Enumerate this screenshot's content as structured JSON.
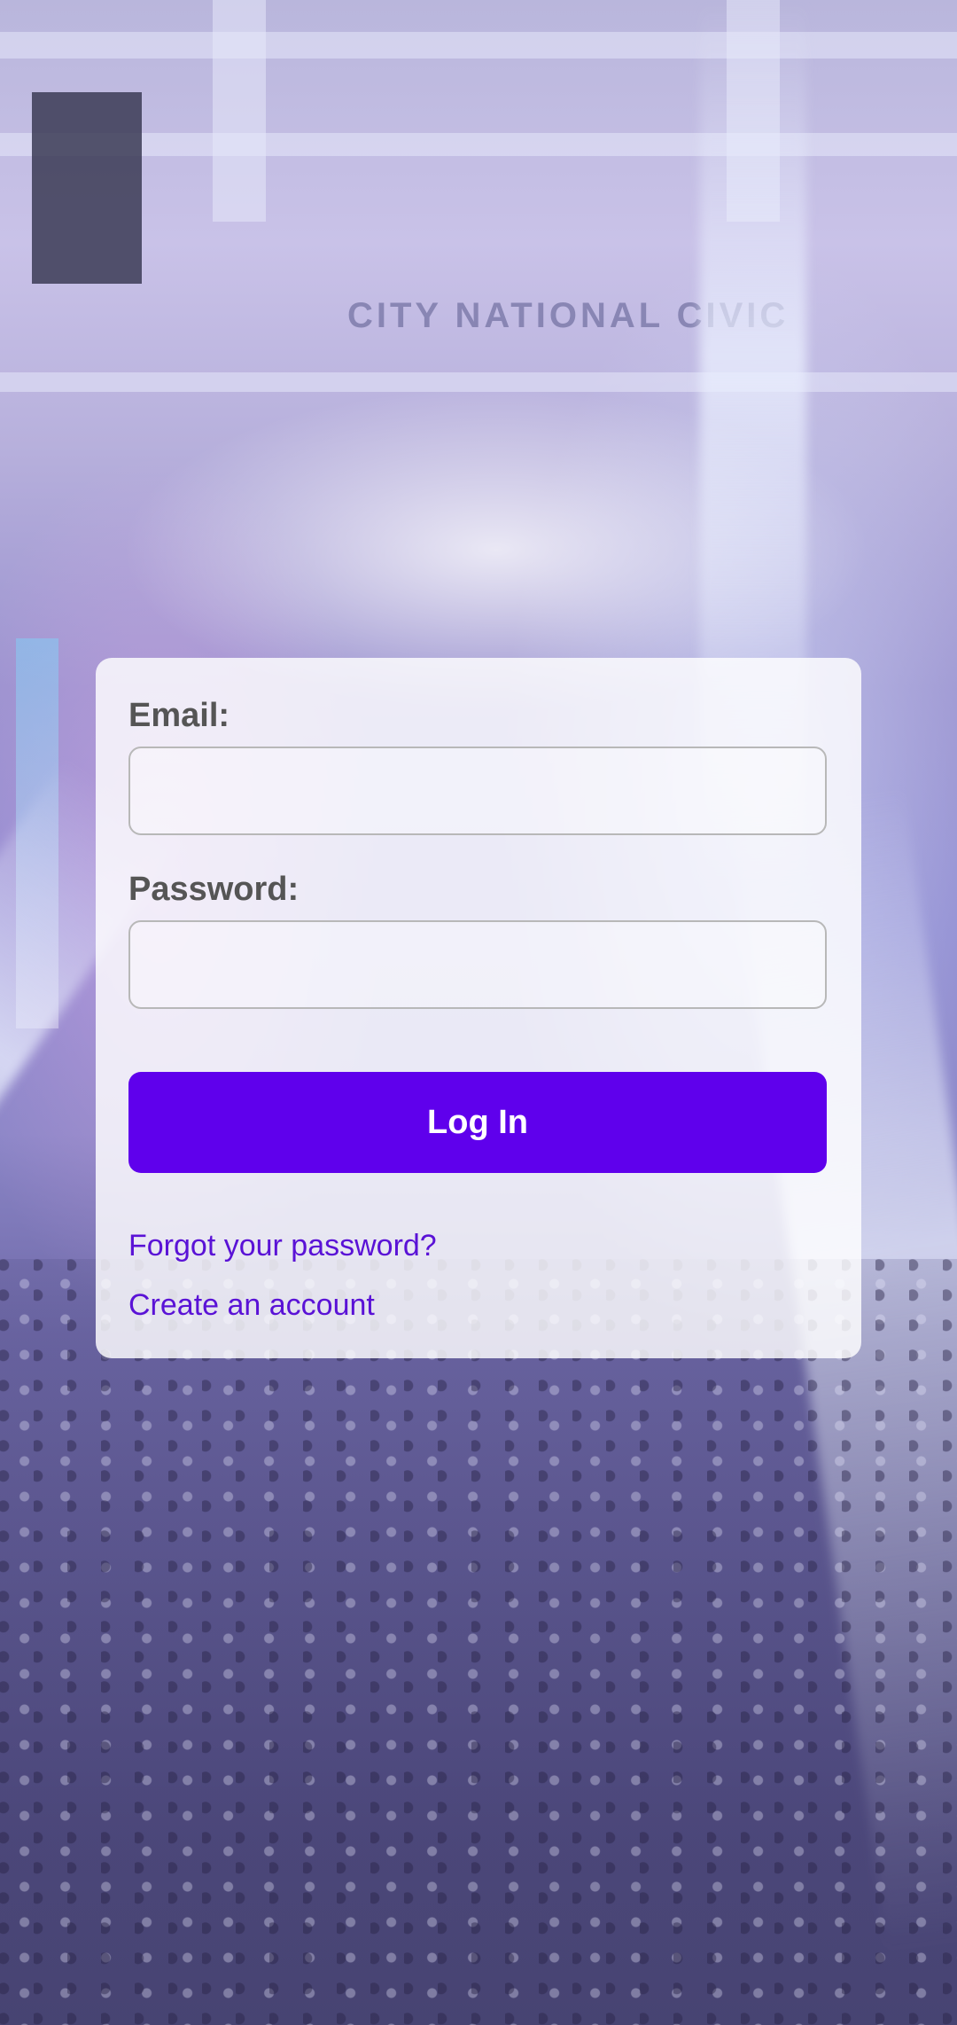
{
  "background": {
    "venue_sign_text": "CITY NATIONAL CIVIC"
  },
  "login_form": {
    "email_label": "Email:",
    "email_value": "",
    "email_placeholder": "",
    "password_label": "Password:",
    "password_value": "",
    "password_placeholder": "",
    "login_button_label": "Log In",
    "forgot_password_link": "Forgot your password?",
    "create_account_link": "Create an account"
  },
  "colors": {
    "primary_button": "#5f00ec",
    "link": "#5a12d6",
    "label": "#555555"
  }
}
